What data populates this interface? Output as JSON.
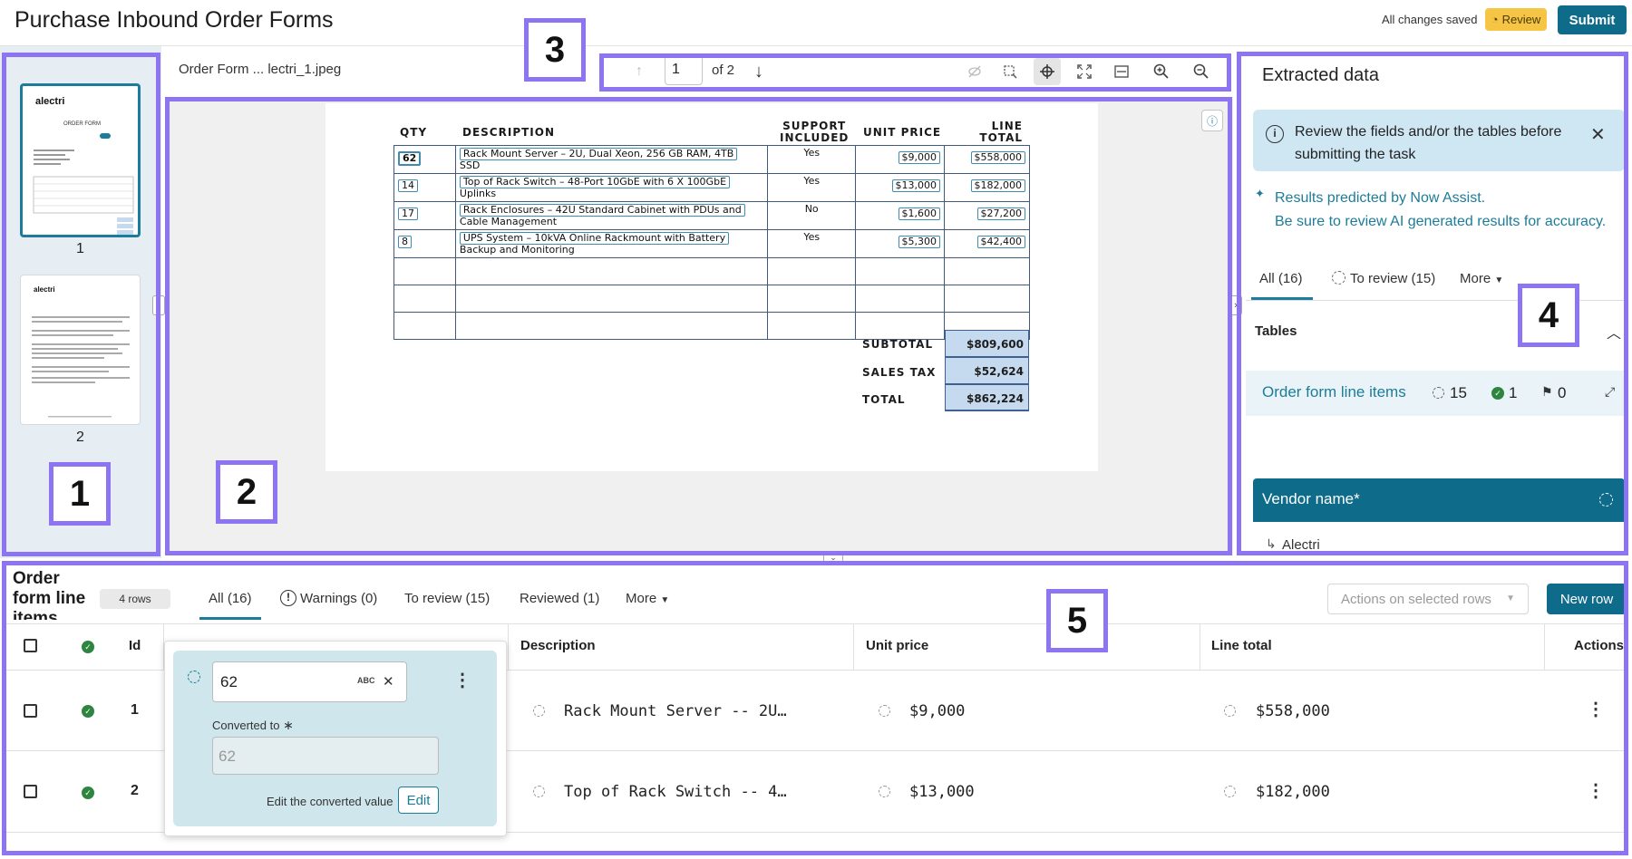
{
  "header": {
    "title": "Purchase Inbound Order Forms",
    "saved_status": "All changes saved",
    "review_label": "Review",
    "submit_label": "Submit"
  },
  "callouts": [
    "1",
    "2",
    "3",
    "4",
    "5"
  ],
  "thumbnails": {
    "page1_num": "1",
    "page2_num": "2",
    "page1_logo": "alectri",
    "page1_heading": "ORDER FORM",
    "page2_logo": "alectri"
  },
  "viewer": {
    "doc_name": "Order Form ... lectri_1.jpeg",
    "page_value": "1",
    "page_of": "of 2"
  },
  "document": {
    "headers": {
      "qty": "QTY",
      "description": "DESCRIPTION",
      "support_line1": "SUPPORT",
      "support_line2": "INCLUDED",
      "unit_price": "UNIT PRICE",
      "line_total_line1": "LINE",
      "line_total_line2": "TOTAL"
    },
    "rows": [
      {
        "qty": "62",
        "desc1": "Rack Mount Server – 2U, Dual Xeon, 256 GB RAM, 4TB",
        "desc2": "SSD",
        "support": "Yes",
        "unit": "$9,000",
        "total": "$558,000"
      },
      {
        "qty": "14",
        "desc1": "Top of Rack Switch – 48-Port 10GbE with 6 X 100GbE",
        "desc2": "Uplinks",
        "support": "Yes",
        "unit": "$13,000",
        "total": "$182,000"
      },
      {
        "qty": "17",
        "desc1": "Rack Enclosures – 42U Standard Cabinet with PDUs and",
        "desc2": "Cable Management",
        "support": "No",
        "unit": "$1,600",
        "total": "$27,200"
      },
      {
        "qty": "8",
        "desc1": "UPS System – 10kVA Online Rackmount with Battery",
        "desc2": "Backup and Monitoring",
        "support": "Yes",
        "unit": "$5,300",
        "total": "$42,400"
      }
    ],
    "subtotal_label": "SUBTOTAL",
    "subtotal_value": "$809,600",
    "tax_label": "SALES TAX",
    "tax_value": "$52,624",
    "total_label": "TOTAL",
    "total_value": "$862,224"
  },
  "extracted": {
    "title": "Extracted data",
    "banner_text": "Review the fields and/or the tables before submitting the task",
    "ai_line1": "Results predicted by Now Assist.",
    "ai_line2": "Be sure to review AI generated results for accuracy.",
    "tabs": {
      "all": "All (16)",
      "to_review": "To review (15)",
      "more": "More"
    },
    "tables_label": "Tables",
    "table_item": {
      "label": "Order form line items",
      "pending": "15",
      "reviewed": "1",
      "flagged": "0"
    },
    "vendor_label": "Vendor name*",
    "vendor_value": "Alectri"
  },
  "bottom": {
    "title": "Order form line items",
    "rows_badge": "4 rows",
    "tabs": {
      "all": "All (16)",
      "warnings": "Warnings (0)",
      "to_review": "To review (15)",
      "reviewed": "Reviewed (1)",
      "more": "More"
    },
    "actions_placeholder": "Actions on selected rows",
    "new_row_label": "New row",
    "columns": {
      "id": "Id",
      "description": "Description",
      "unit_price": "Unit price",
      "line_total": "Line total",
      "actions": "Actions"
    },
    "rows": [
      {
        "id": "1",
        "description": "Rack Mount Server -- 2U…",
        "unit_price": "$9,000",
        "line_total": "$558,000"
      },
      {
        "id": "2",
        "description": "Top of Rack Switch -- 4…",
        "unit_price": "$13,000",
        "line_total": "$182,000"
      }
    ]
  },
  "popup": {
    "value": "62",
    "abc_label": "ABC",
    "converted_label": "Converted to",
    "converted_value": "62",
    "edit_hint": "Edit the converted value",
    "edit_label": "Edit"
  },
  "colors": {
    "accent": "#1c7c99",
    "primary_button": "#0f6b8a",
    "highlight": "#8c74f2",
    "review_badge": "#f6c545",
    "success": "#2e8540"
  }
}
